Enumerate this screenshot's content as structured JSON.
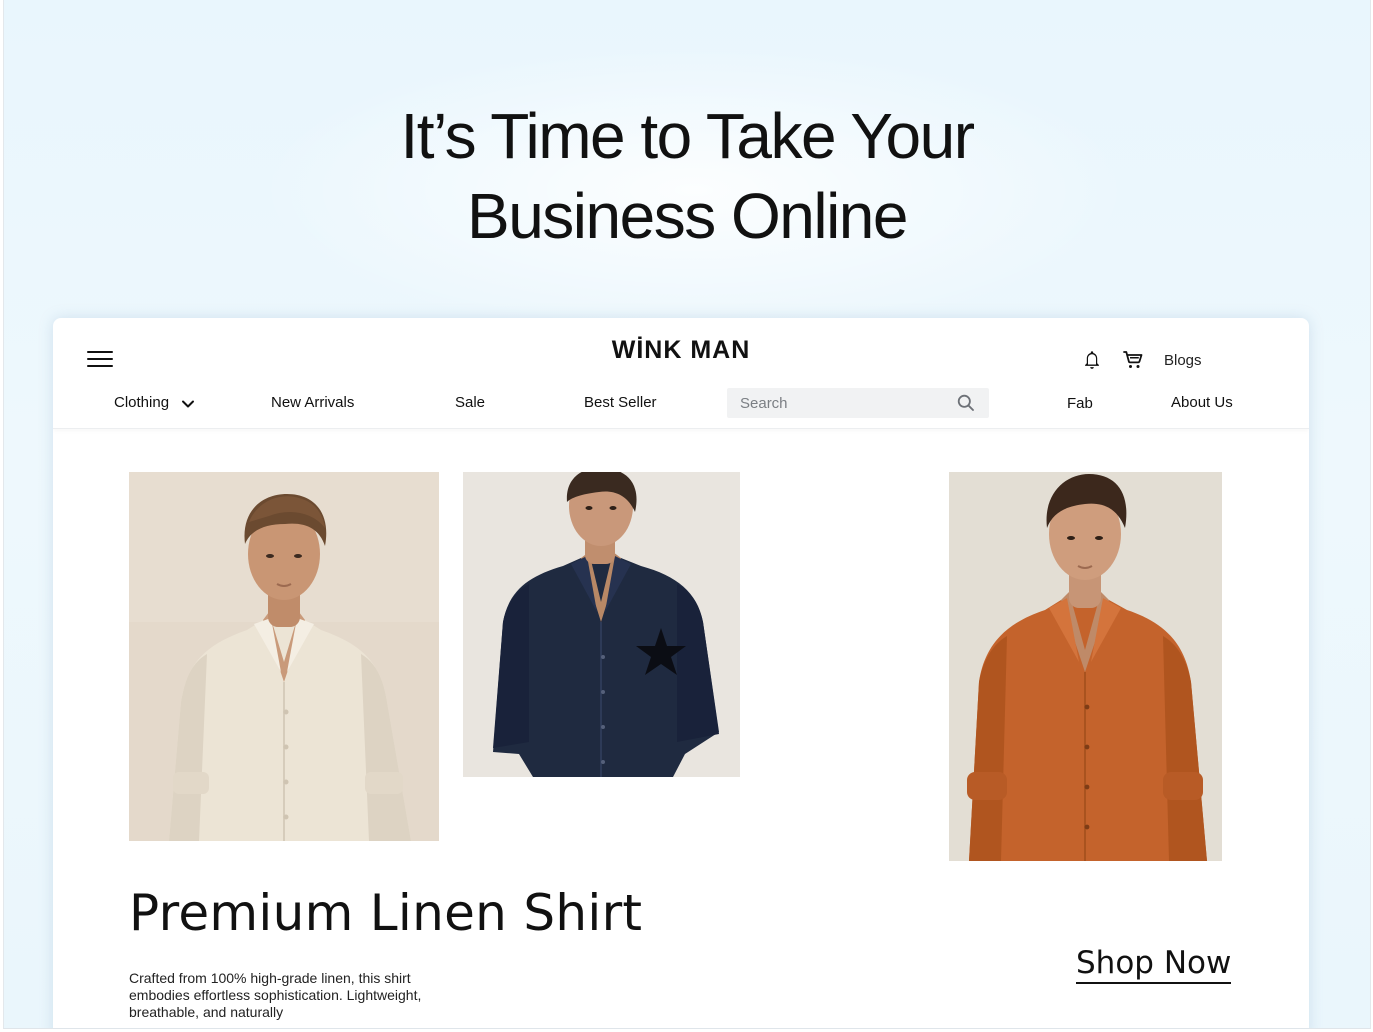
{
  "hero": {
    "line1": "It’s Time to Take Your",
    "line2": "Business Online"
  },
  "site": {
    "logo": "WİNK MAN",
    "header_icons": [
      "menu-icon",
      "bell-icon",
      "cart-icon"
    ],
    "blogs_label": "Blogs",
    "nav": {
      "clothing": "Clothing",
      "new_arrivals": "New Arrivals",
      "sale": "Sale",
      "best_seller": "Best Seller",
      "fab": "Fab",
      "about_us": "About Us"
    },
    "search": {
      "placeholder": "Search"
    }
  },
  "product": {
    "title": "Premium Linen Shirt",
    "description": "Crafted from 100% high-grade linen, this shirt embodies effortless sophistication. Lightweight, breathable, and naturally",
    "cta": "Shop Now"
  },
  "colors": {
    "page_background": "#eaf6fc",
    "text": "#111111",
    "shirt_cream": "#ece4d4",
    "shirt_navy": "#1e2a3f",
    "shirt_rust": "#c4632c"
  }
}
